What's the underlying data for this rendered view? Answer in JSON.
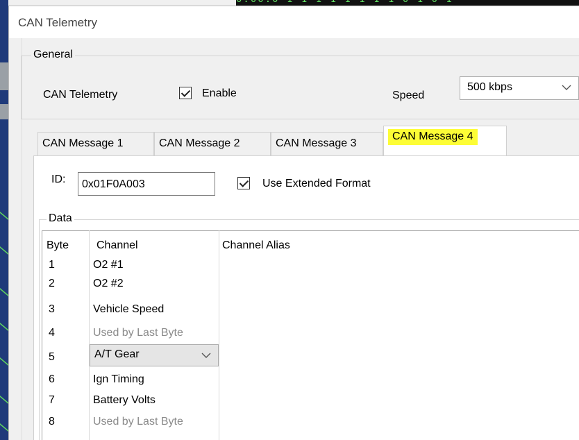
{
  "window": {
    "title": "CAN Telemetry"
  },
  "general": {
    "legend": "General",
    "telemetry_label": "CAN Telemetry",
    "enable_label": "Enable",
    "enable_checked": true,
    "speed_label": "Speed",
    "speed_value": "500 kbps"
  },
  "tabs": [
    {
      "label": "CAN Message 1",
      "active": false
    },
    {
      "label": "CAN Message 2",
      "active": false
    },
    {
      "label": "CAN Message 3",
      "active": false
    },
    {
      "label": "CAN Message 4",
      "active": true,
      "highlight": "#fdfd36"
    }
  ],
  "message": {
    "id_label": "ID:",
    "id_value": "0x01F0A003",
    "extended_label": "Use Extended Format",
    "extended_checked": true
  },
  "data": {
    "legend": "Data",
    "columns": [
      "Byte",
      "Channel",
      "Channel Alias"
    ],
    "rows": [
      {
        "byte": "1",
        "channel": "O2 #1",
        "alias": "",
        "muted": false
      },
      {
        "byte": "2",
        "channel": "O2 #2",
        "alias": "",
        "muted": false
      },
      {
        "byte": "3",
        "channel": "Vehicle Speed",
        "alias": "",
        "muted": false
      },
      {
        "byte": "4",
        "channel": "Used by Last Byte",
        "alias": "",
        "muted": true
      },
      {
        "byte": "5",
        "channel": "A/T Gear",
        "alias": "",
        "muted": false,
        "dropdown": true
      },
      {
        "byte": "6",
        "channel": "Ign Timing",
        "alias": "",
        "muted": false
      },
      {
        "byte": "7",
        "channel": "Battery Volts",
        "alias": "",
        "muted": false
      },
      {
        "byte": "8",
        "channel": "Used by Last Byte",
        "alias": "",
        "muted": true
      }
    ]
  },
  "colors": {
    "highlight": "#fdfd36",
    "muted_text": "#8a8a8a",
    "background": "#f0f0f0"
  },
  "icons": {
    "dropdown": "chevron-down-icon",
    "checkbox": "checkmark-icon"
  }
}
